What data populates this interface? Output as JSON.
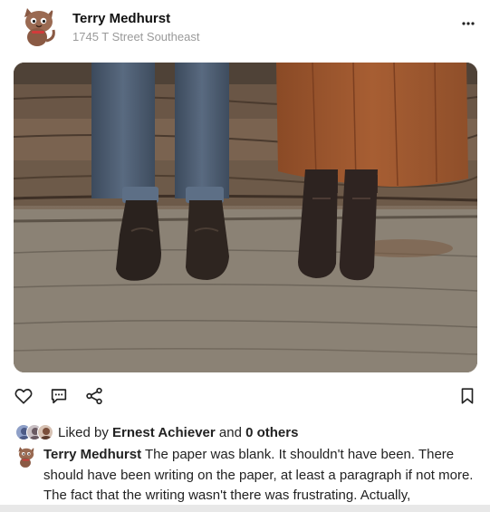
{
  "post": {
    "author_name": "Terry Medhurst",
    "author_location": "1745 T Street Southeast",
    "more_icon": "more-horizontal-icon",
    "image_alt": "Two pairs of leather boots standing on weathered wooden planks"
  },
  "actions": {
    "like_icon": "heart-icon",
    "comment_icon": "comment-icon",
    "share_icon": "share-icon",
    "save_icon": "bookmark-icon"
  },
  "likes": {
    "prefix": "Liked by",
    "user": "Ernest Achiever",
    "joiner": "and",
    "others": "0 others"
  },
  "caption": {
    "author": "Terry Medhurst",
    "text": "The paper was blank. It shouldn't have been. There should have been writing on the paper, at least a paragraph if not more. The fact that the writing wasn't there was frustrating. Actually,"
  }
}
